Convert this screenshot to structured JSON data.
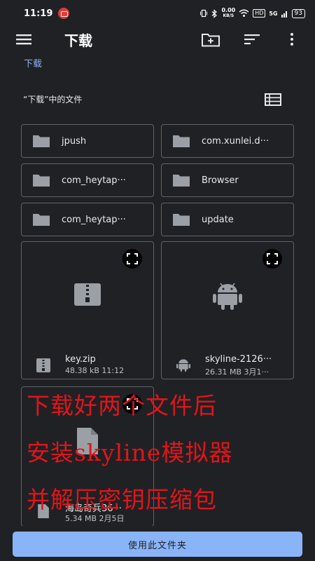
{
  "status_bar": {
    "time": "11:19",
    "net_speed_value": "0.00",
    "net_speed_unit": "KB/S",
    "hd": "HD",
    "signal": "5G",
    "battery": "93"
  },
  "app_bar": {
    "title": "下载",
    "icons": [
      "menu-icon",
      "new-folder-icon",
      "sort-icon",
      "more-vert-icon"
    ]
  },
  "breadcrumb": "下载",
  "section": {
    "heading": "“下载”中的文件",
    "view_icon": "list-view-icon"
  },
  "folders": [
    {
      "label": "jpush"
    },
    {
      "label": "com.xunlei.d···"
    },
    {
      "label": "com_heytap···"
    },
    {
      "label": "Browser"
    },
    {
      "label": "com_heytap···"
    },
    {
      "label": "update"
    }
  ],
  "files": [
    {
      "name": "key.zip",
      "meta": "48.38 kB 11:12",
      "icon": "zip-icon"
    },
    {
      "name": "skyline-2126···",
      "meta": "26.31 MB 3月1···",
      "icon": "android-icon"
    },
    {
      "name": "海岛奇兵36···",
      "meta": "5.34 MB 2月5日",
      "icon": "file-icon"
    }
  ],
  "overlay_text": [
    "下载好两个文件后",
    "安装skyline模拟器",
    "并解压密钥压缩包"
  ],
  "bottom": {
    "use_folder_label": "使用此文件夹"
  },
  "colors": {
    "background": "#202124",
    "accent": "#8ab4f8",
    "overlay_text": "#e0151b"
  }
}
